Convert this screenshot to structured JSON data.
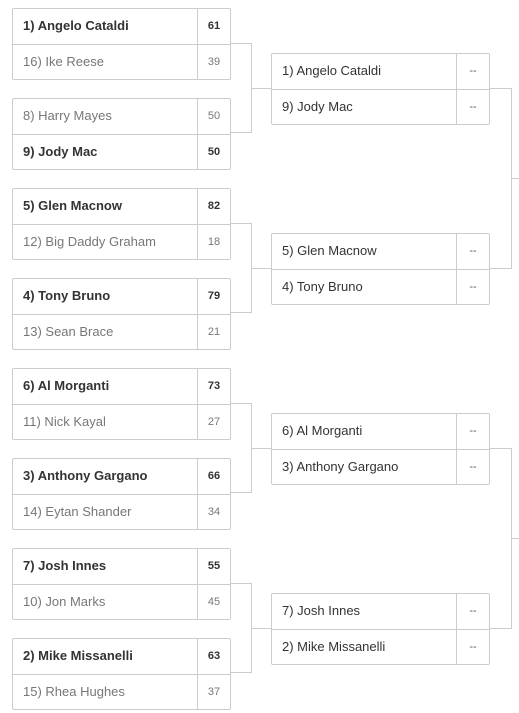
{
  "bracket": {
    "round1": [
      {
        "teams": [
          {
            "name": "1) Angelo Cataldi",
            "score": "61",
            "winner": true
          },
          {
            "name": "16) Ike Reese",
            "score": "39",
            "winner": false
          }
        ]
      },
      {
        "teams": [
          {
            "name": "8) Harry Mayes",
            "score": "50",
            "winner": false
          },
          {
            "name": "9) Jody Mac",
            "score": "50",
            "winner": true
          }
        ]
      },
      {
        "teams": [
          {
            "name": "5) Glen Macnow",
            "score": "82",
            "winner": true
          },
          {
            "name": "12) Big Daddy Graham",
            "score": "18",
            "winner": false
          }
        ]
      },
      {
        "teams": [
          {
            "name": "4) Tony Bruno",
            "score": "79",
            "winner": true
          },
          {
            "name": "13) Sean Brace",
            "score": "21",
            "winner": false
          }
        ]
      },
      {
        "teams": [
          {
            "name": "6) Al Morganti",
            "score": "73",
            "winner": true
          },
          {
            "name": "11) Nick Kayal",
            "score": "27",
            "winner": false
          }
        ]
      },
      {
        "teams": [
          {
            "name": "3) Anthony Gargano",
            "score": "66",
            "winner": true
          },
          {
            "name": "14) Eytan Shander",
            "score": "34",
            "winner": false
          }
        ]
      },
      {
        "teams": [
          {
            "name": "7) Josh Innes",
            "score": "55",
            "winner": true
          },
          {
            "name": "10) Jon Marks",
            "score": "45",
            "winner": false
          }
        ]
      },
      {
        "teams": [
          {
            "name": "2) Mike Missanelli",
            "score": "63",
            "winner": true
          },
          {
            "name": "15) Rhea Hughes",
            "score": "37",
            "winner": false
          }
        ]
      }
    ],
    "round2": [
      {
        "teams": [
          {
            "name": "1) Angelo Cataldi",
            "score": "--"
          },
          {
            "name": "9) Jody Mac",
            "score": "--"
          }
        ]
      },
      {
        "teams": [
          {
            "name": "5) Glen Macnow",
            "score": "--"
          },
          {
            "name": "4) Tony Bruno",
            "score": "--"
          }
        ]
      },
      {
        "teams": [
          {
            "name": "6) Al Morganti",
            "score": "--"
          },
          {
            "name": "3) Anthony Gargano",
            "score": "--"
          }
        ]
      },
      {
        "teams": [
          {
            "name": "7) Josh Innes",
            "score": "--"
          },
          {
            "name": "2) Mike Missanelli",
            "score": "--"
          }
        ]
      }
    ]
  },
  "colors": {
    "border": "#cccccc",
    "winner_text": "#333333",
    "loser_text": "#777777"
  }
}
